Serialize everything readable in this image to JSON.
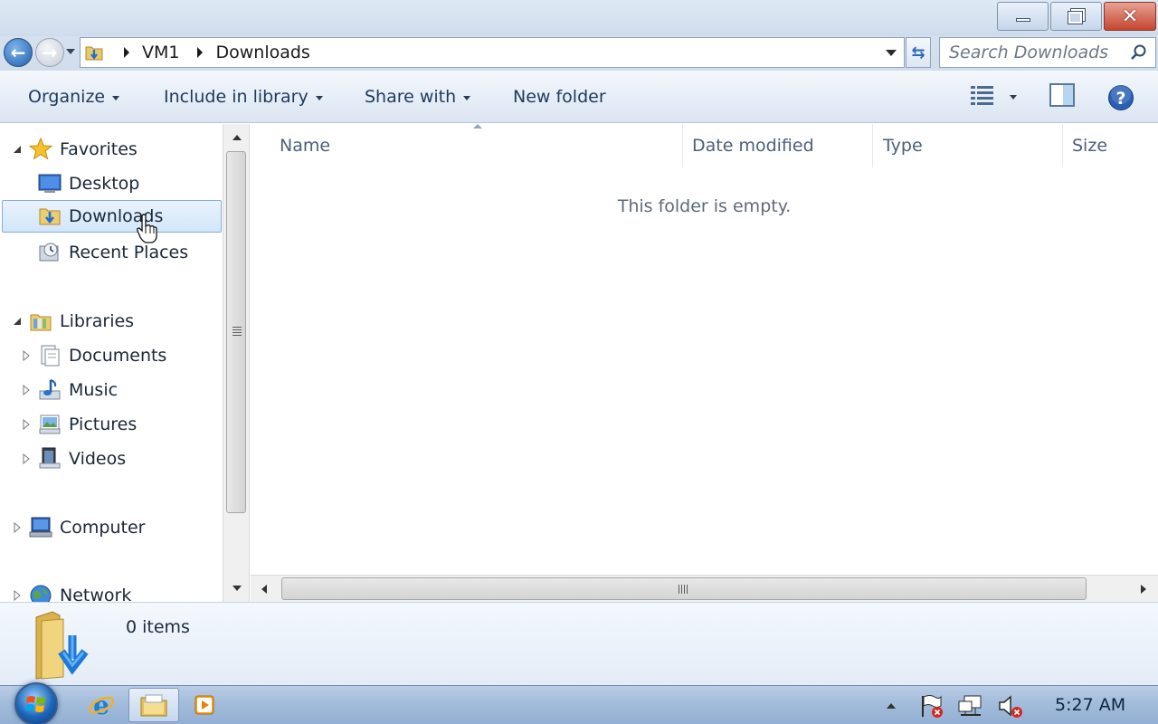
{
  "window": {
    "minimize_label": "Minimize",
    "restore_label": "Restore",
    "close_label": "Close"
  },
  "address": {
    "crumbs": [
      "VM1",
      "Downloads"
    ],
    "search_placeholder": "Search Downloads"
  },
  "toolbar": {
    "organize": "Organize",
    "include_in_library": "Include in library",
    "share_with": "Share with",
    "new_folder": "New folder"
  },
  "nav": {
    "favorites": "Favorites",
    "desktop": "Desktop",
    "downloads": "Downloads",
    "recent_places": "Recent Places",
    "libraries": "Libraries",
    "documents": "Documents",
    "music": "Music",
    "pictures": "Pictures",
    "videos": "Videos",
    "computer": "Computer",
    "network": "Network",
    "selected": "Downloads"
  },
  "columns": {
    "name": "Name",
    "date_modified": "Date modified",
    "type": "Type",
    "size": "Size"
  },
  "content": {
    "empty_message": "This folder is empty."
  },
  "details": {
    "item_count": "0 items"
  },
  "taskbar": {
    "clock": "5:27 AM",
    "apps": [
      "internet-explorer-icon",
      "windows-explorer-icon",
      "media-player-icon"
    ]
  },
  "colors": {
    "accent": "#2b69b8",
    "selection_bg": "#d3e6fa",
    "selection_border": "#84acdd",
    "close_red": "#c54530"
  }
}
